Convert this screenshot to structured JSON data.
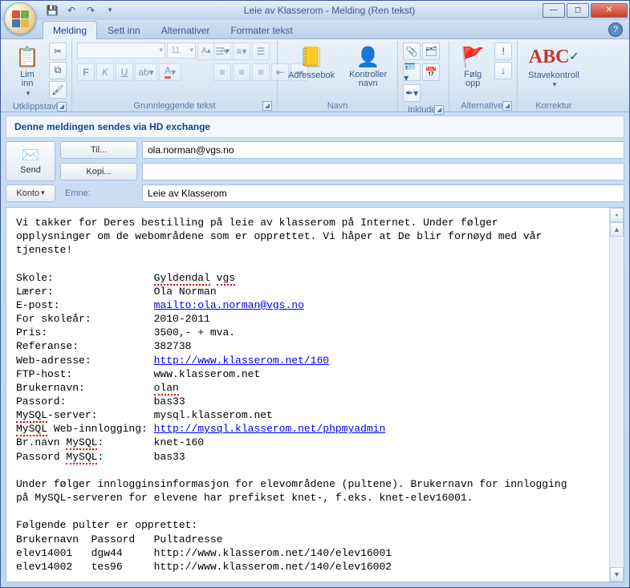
{
  "window": {
    "title": "Leie av Klasserom - Melding (Ren tekst)"
  },
  "qat": {
    "save": "save-icon",
    "undo": "undo-icon",
    "redo": "redo-icon"
  },
  "tabs": {
    "message": "Melding",
    "insert": "Sett inn",
    "options": "Alternativer",
    "format": "Formater tekst"
  },
  "ribbon": {
    "clipboard": {
      "paste": "Lim\ninn",
      "label": "Utklippstavle"
    },
    "font": {
      "label": "Grunnleggende tekst",
      "size": "11"
    },
    "names": {
      "addressbook": "Adressebok",
      "checknames": "Kontroller\nnavn",
      "label": "Navn"
    },
    "include": {
      "label": "Inkluder"
    },
    "followup": {
      "label": "Følg\nopp",
      "group": "Alternativer"
    },
    "proof": {
      "spell": "Stavekontroll",
      "label": "Korrektur"
    }
  },
  "infobar": "Denne meldingen sendes via HD exchange",
  "header": {
    "send": "Send",
    "to_btn": "Til...",
    "to_val": "ola.norman@vgs.no",
    "cc_btn": "Kopi...",
    "cc_val": "",
    "account": "Konto",
    "subject_lbl": "Emne:",
    "subject_val": "Leie av Klasserom"
  },
  "body": {
    "intro": "Vi takker for Deres bestilling på leie av klasserom på Internet. Under følger\nopplysninger om de webområdene som er opprettet. Vi håper at De blir fornøyd med vår\ntjeneste!",
    "fields": {
      "skole_lbl": "Skole:",
      "skole_val": "Gyldendal vgs",
      "laerer_lbl": "Lærer:",
      "laerer_val": "Ola Norman",
      "epost_lbl": "E-post:",
      "epost_val": "mailto:ola.norman@vgs.no",
      "aar_lbl": "For skoleår:",
      "aar_val": "2010-2011",
      "pris_lbl": "Pris:",
      "pris_val": "3500,- + mva.",
      "ref_lbl": "Referanse:",
      "ref_val": "382738",
      "web_lbl": "Web-adresse:",
      "web_val": "http://www.klasserom.net/160",
      "ftp_lbl": "FTP-host:",
      "ftp_val": "www.klasserom.net",
      "user_lbl": "Brukernavn:",
      "user_val": "olan",
      "pass_lbl": "Passord:",
      "pass_val": "bas33",
      "mysqlsrv_lbl": "MySQL-server:",
      "mysqlsrv_val": "mysql.klasserom.net",
      "mysqlweb_lbl": "MySQL Web-innlogging:",
      "mysqlweb_val": "http://mysql.klasserom.net/phpmyadmin",
      "bruser_lbl": "Br.navn MySQL:",
      "bruser_val": "knet-160",
      "brpass_lbl": "Passord MySQL:",
      "brpass_val": "bas33"
    },
    "para2": "Under følger innlogginsinformasjon for elevområdene (pultene). Brukernavn for innlogging\npå MySQL-serveren for elevene har prefikset knet-, f.eks. knet-elev16001.",
    "pulterhdr": "Følgende pulter er opprettet:",
    "tablehdr": "Brukernavn  Passord   Pultadresse",
    "rows": [
      "elev14001   dgw44     http://www.klasserom.net/140/elev16001",
      "elev14002   tes96     http://www.klasserom.net/140/elev16002"
    ]
  }
}
